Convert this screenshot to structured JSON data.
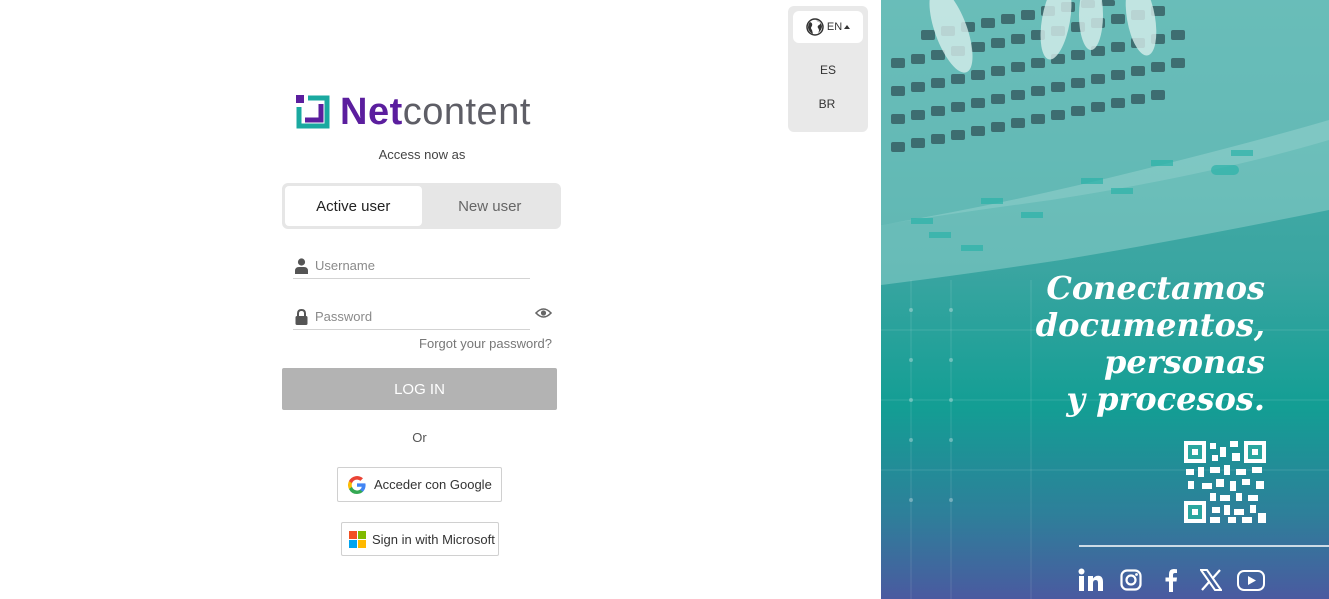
{
  "brand": {
    "name_part1": "Net",
    "name_part2": "content",
    "colors": {
      "primary": "#5b1e9e",
      "teal": "#1aa9a0",
      "gray_text": "#5e5e66"
    }
  },
  "login": {
    "access_now_label": "Access now as",
    "tabs": [
      {
        "label": "Active user",
        "active": true
      },
      {
        "label": "New user",
        "active": false
      }
    ],
    "username_placeholder": "Username",
    "password_placeholder": "Password",
    "forgot_password": "Forgot your password?",
    "login_button": "LOG IN",
    "or_label": "Or",
    "google_button": "Acceder con Google",
    "microsoft_button": "Sign in with Microsoft"
  },
  "language": {
    "current": "EN",
    "options": [
      "ES",
      "BR"
    ]
  },
  "hero": {
    "quote_lines": [
      "Conectamos",
      "documentos,",
      "personas",
      "y procesos."
    ],
    "social_icons": [
      "linkedin-icon",
      "instagram-icon",
      "facebook-icon",
      "x-icon",
      "youtube-icon"
    ]
  }
}
